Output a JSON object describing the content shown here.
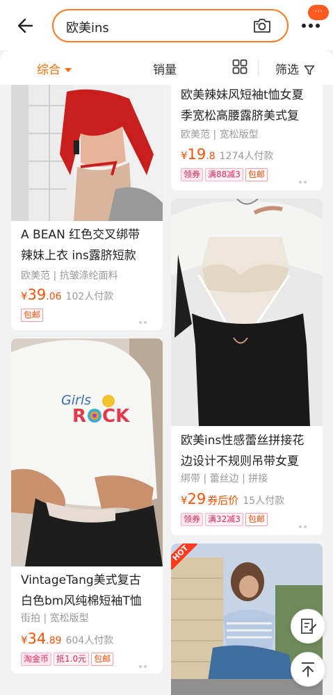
{
  "header": {
    "search_query": "欧美ins",
    "notification_badge": "···"
  },
  "sortbar": {
    "comprehensive": "综合",
    "sales": "销量",
    "filter": "筛选"
  },
  "products": [
    {
      "id": "left-1",
      "title_lines": [
        "A BEAN 红色交叉绑带",
        "辣妹上衣 ins露脐短款"
      ],
      "attrs": "欧美范 | 抗皱涤纶面料",
      "price_int": "39",
      "price_dec": ".06",
      "price_suffix": "",
      "sold": "102人付款",
      "tags": [
        "包邮"
      ]
    },
    {
      "id": "left-2",
      "title_lines": [
        "VintageTang美式复古",
        "白色bm风纯棉短袖T恤"
      ],
      "attrs": "街拍 | 宽松版型",
      "price_int": "34",
      "price_dec": ".89",
      "price_suffix": "",
      "sold": "604人付款",
      "tags": [
        "淘金币",
        "抵1.0元",
        "包邮"
      ],
      "image_text": "Girls ROCK"
    },
    {
      "id": "right-1",
      "title_lines": [
        "欧美辣妹风短袖t恤女夏",
        "季宽松高腰露脐美式复"
      ],
      "attrs": "欧美范 | 宽松版型",
      "price_int": "19",
      "price_dec": ".8",
      "price_suffix": "",
      "sold": "1274人付款",
      "tags": [
        "领券",
        "满88减3",
        "包邮"
      ]
    },
    {
      "id": "right-2",
      "title_lines": [
        "欧美ins性感蕾丝拼接花",
        "边设计不规则吊带女夏"
      ],
      "attrs": "绑带 | 蕾丝边 | 拼接",
      "price_int": "29",
      "price_dec": "",
      "price_suffix": "券后价",
      "sold": "15人付款",
      "tags": [
        "领券",
        "满32减3",
        "包邮"
      ]
    },
    {
      "id": "right-3",
      "hot_label": "HOT"
    }
  ],
  "currency_symbol": "¥",
  "colors": {
    "accent": "#ff6a00",
    "price": "#ff5000"
  }
}
